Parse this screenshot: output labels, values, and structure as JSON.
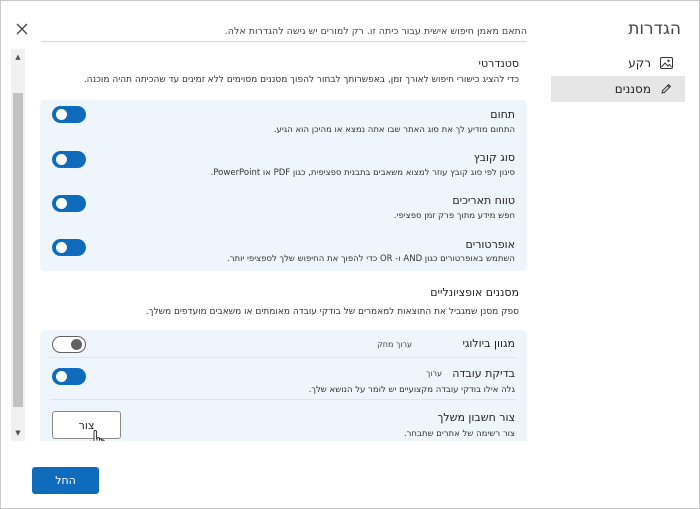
{
  "nav": {
    "title": "הגדרות",
    "items": [
      {
        "label": "רקע",
        "icon": "image-icon",
        "selected": false
      },
      {
        "label": "מסננים",
        "icon": "pencil-icon",
        "selected": true
      }
    ]
  },
  "header": {
    "description": "התאם מאמן חיפוש אישית עבור כיתה זו. רק למורים יש גישה להגדרות אלה."
  },
  "standard": {
    "title": "סטנדרטי",
    "description": "כדי להציג כישורי חיפוש לאורך זמן, באפשרותך לבחור להפוך מסננים מסוימים ללא זמינים עד שהכיתה תהיה מוכנה.",
    "rows": [
      {
        "title": "תחום",
        "desc": "התחום מודיע לך את סוג האתר שבו אתה נמצא או מהיכן הוא הגיע.",
        "on": true
      },
      {
        "title": "סוג קובץ",
        "desc": "סינון לפי סוג קובץ עוזר למצוא משאבים בתבנית ספציפית, כגון PDF או PowerPoint.",
        "on": true
      },
      {
        "title": "טווח תאריכים",
        "desc": "חפש מידע מתוך פרק זמן ספציפי.",
        "on": true
      },
      {
        "title": "אופרטורים",
        "desc": "השתמש באופרטורים כגון AND ו- OR כדי להפוך את החיפוש שלך לספציפי יותר.",
        "on": true
      }
    ]
  },
  "optional": {
    "title": "מסננים אופציונליים",
    "description": "ספק מסנן שמגביל את התוצאות למאמרים של בודקי עובדה מאומתים או משאבים מועדפים משלך.",
    "rows": [
      {
        "title": "מגוון ביולוגי",
        "tag": "ערוך מחק",
        "on": false
      },
      {
        "title": "בדיקת עובדה",
        "tag": "ערוך",
        "desc": "גלה אילו בודקי עובדה מקצועיים יש לומר על הנושא שלך.",
        "on": true
      },
      {
        "title": "צור חשבון משלך",
        "desc": "צור רשימה של אתרים שתבחר.",
        "button": "צור"
      }
    ]
  },
  "footer": {
    "apply_label": "החל"
  }
}
